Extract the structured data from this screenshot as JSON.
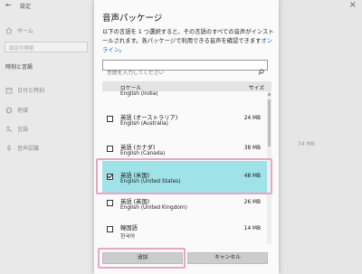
{
  "window": {
    "title": "設定",
    "back_glyph": "←",
    "close_glyph": "×"
  },
  "sidebar": {
    "home_label": "ホーム",
    "search_placeholder": "設定の検索",
    "section_heading": "時刻と言語",
    "items": [
      {
        "label": "日付と時刻",
        "icon": "calendar-icon"
      },
      {
        "label": "地域",
        "icon": "globe-icon"
      },
      {
        "label": "言語",
        "icon": "language-icon"
      },
      {
        "label": "音声認識",
        "icon": "microphone-icon"
      }
    ]
  },
  "background": {
    "size_label": "34 MB"
  },
  "dialog": {
    "title": "音声パッケージ",
    "description": "以下の言語を 1 つ選択すると、その言語のすべての音声がインストールされます。各パッケージで利用できる音声を確認できます",
    "link_text": "オンライン",
    "link_suffix": "。",
    "search_placeholder": "言語を入力してください",
    "columns": {
      "locale": "ロケール",
      "size": "サイズ"
    },
    "rows": [
      {
        "name_ja": "",
        "name_en": "English (India)",
        "size": "",
        "checked": false,
        "partial": true
      },
      {
        "name_ja": "英語 (オーストラリア)",
        "name_en": "English (Australia)",
        "size": "24 MB",
        "checked": false
      },
      {
        "name_ja": "英語 (カナダ)",
        "name_en": "English (Canada)",
        "size": "38 MB",
        "checked": false
      },
      {
        "name_ja": "英語 (米国)",
        "name_en": "English (United States)",
        "size": "48 MB",
        "checked": true,
        "selected": true
      },
      {
        "name_ja": "英語 (英国)",
        "name_en": "English (United Kingdom)",
        "size": "26 MB",
        "checked": false
      },
      {
        "name_ja": "韓国語",
        "name_en": "한국어",
        "size": "14 MB",
        "checked": false
      }
    ],
    "add_button": "追加",
    "cancel_button": "キャンセル"
  },
  "colors": {
    "selected_row": "#9fe2e8",
    "highlight": "#e8a5c4",
    "link": "#0a66c8"
  }
}
